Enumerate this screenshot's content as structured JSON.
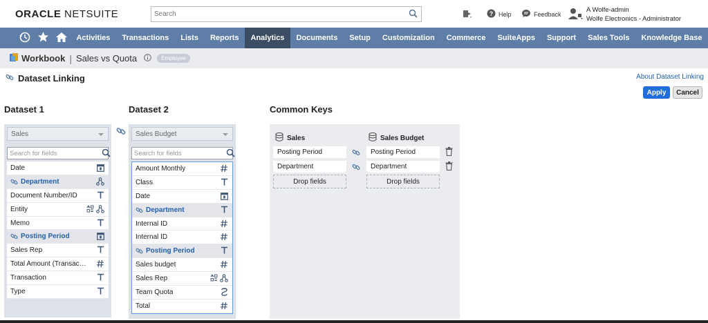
{
  "app": {
    "logo_bold": "ORACLE",
    "logo_rest": " NETSUITE"
  },
  "search": {
    "placeholder": "Search"
  },
  "topbar": {
    "help": "Help",
    "feedback": "Feedback",
    "user_name": "A Wolfe-admin",
    "user_role": "Wolfe Electronics - Administrator"
  },
  "nav": {
    "items": [
      "Activities",
      "Transactions",
      "Lists",
      "Reports",
      "Analytics",
      "Documents",
      "Setup",
      "Customization",
      "Commerce",
      "SuiteApps",
      "Support",
      "Sales Tools",
      "Knowledge Base"
    ],
    "active": "Analytics"
  },
  "title": {
    "workbook": "Workbook",
    "name": "Sales vs Quota",
    "badge": "Employee"
  },
  "page": {
    "heading": "Dataset Linking",
    "about_link": "About Dataset Linking",
    "apply": "Apply",
    "cancel": "Cancel"
  },
  "dataset1": {
    "header": "Dataset 1",
    "selected": "Sales",
    "search_placeholder": "Search for fields",
    "fields": [
      {
        "label": "Date",
        "type": "calendar-icon",
        "linked": false
      },
      {
        "label": "Department",
        "type": "hierarchy-icon",
        "linked": true
      },
      {
        "label": "Document Number/ID",
        "type": "text-type-icon",
        "linked": false
      },
      {
        "label": "Entity",
        "type": "multi-icon",
        "linked": false
      },
      {
        "label": "Memo",
        "type": "text-type-icon",
        "linked": false
      },
      {
        "label": "Posting Period",
        "type": "calendar-icon",
        "linked": true
      },
      {
        "label": "Sales Rep",
        "type": "text-type-icon",
        "linked": false
      },
      {
        "label": "Total Amount (Transaction...",
        "type": "number-icon",
        "linked": false
      },
      {
        "label": "Transaction",
        "type": "text-type-icon",
        "linked": false
      },
      {
        "label": "Type",
        "type": "text-type-icon",
        "linked": false
      }
    ]
  },
  "dataset2": {
    "header": "Dataset 2",
    "selected": "Sales Budget",
    "search_placeholder": "Search for fields",
    "fields": [
      {
        "label": "Amount Monthly",
        "type": "number-icon",
        "linked": false
      },
      {
        "label": "Class",
        "type": "text-type-icon",
        "linked": false
      },
      {
        "label": "Date",
        "type": "calendar-icon",
        "linked": false
      },
      {
        "label": "Department",
        "type": "text-type-icon",
        "linked": true
      },
      {
        "label": "Internal ID",
        "type": "number-icon",
        "linked": false
      },
      {
        "label": "Internal ID",
        "type": "number-icon",
        "linked": false
      },
      {
        "label": "Posting Period",
        "type": "text-type-icon",
        "linked": true
      },
      {
        "label": "Sales budget",
        "type": "number-icon",
        "linked": false
      },
      {
        "label": "Sales Rep",
        "type": "multi-icon",
        "linked": false
      },
      {
        "label": "Team Quota",
        "type": "currency-icon",
        "linked": false
      },
      {
        "label": "Total",
        "type": "number-icon",
        "linked": false
      }
    ]
  },
  "common_keys": {
    "header": "Common Keys",
    "left_title": "Sales",
    "right_title": "Sales Budget",
    "pairs": [
      {
        "left": "Posting Period",
        "right": "Posting Period"
      },
      {
        "left": "Department",
        "right": "Department"
      }
    ],
    "drop_label": "Drop fields"
  }
}
